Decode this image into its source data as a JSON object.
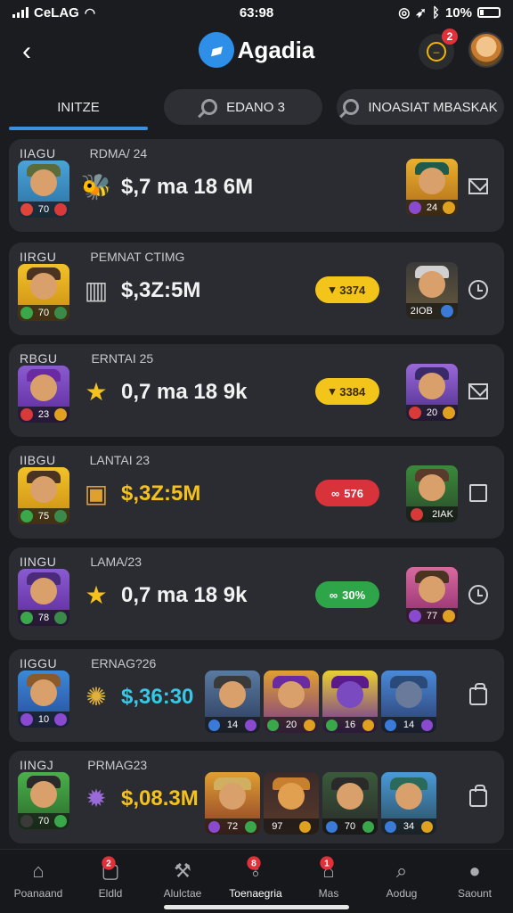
{
  "status": {
    "carrier": "CeLAG",
    "time": "63:98",
    "battery": "10%"
  },
  "header": {
    "title": "Agadia",
    "notif_count": "2"
  },
  "tabs": [
    {
      "label": "INITZE"
    },
    {
      "label": "EDANO 3"
    },
    {
      "label": "INOASIAT MBASKAK"
    }
  ],
  "rows": [
    {
      "tag": "IIAGU",
      "date": "RDMA/ 24",
      "amount": "$,7 ma 18 6M",
      "gem_icon": "bee-icon",
      "hero_level": "70",
      "right_level": "24",
      "action_icon": "mail-icon"
    },
    {
      "tag": "IIRGU",
      "date": "PEMNAT CTIMG",
      "amount": "$,3Z:5M",
      "gem_icon": "tower-icon",
      "hero_level": "70",
      "pill": "3374",
      "pill_style": "yellow",
      "right_level": "2IOB",
      "action_icon": "clock-icon"
    },
    {
      "tag": "RBGU",
      "date": "ERNTAI 25",
      "amount": "0,7 ma 18 9k",
      "gem_icon": "star-icon",
      "hero_level": "23",
      "pill": "3384",
      "pill_style": "yellow",
      "right_level": "20",
      "action_icon": "mail-icon"
    },
    {
      "tag": "IIBGU",
      "date": "LANTAI 23",
      "amount": "$,3Z:5M",
      "gem_icon": "chest-icon",
      "hero_level": "75",
      "pill": "576",
      "pill_style": "red",
      "right_level": "2IAK",
      "action_icon": "square-icon"
    },
    {
      "tag": "IINGU",
      "date": "LAMA/23",
      "amount": "0,7 ma 18 9k",
      "gem_icon": "star-icon",
      "hero_level": "78",
      "pill": "30%",
      "pill_style": "green",
      "right_level": "77",
      "action_icon": "clock-icon"
    },
    {
      "tag": "IIGGU",
      "date": "ERNAG?26",
      "amount": "$,36:30",
      "gem_icon": "coin-icon",
      "hero_level": "10",
      "minis": [
        "14",
        "20",
        "16",
        "14"
      ],
      "action_icon": "bag-icon"
    },
    {
      "tag": "IINGJ",
      "date": "PRMAG23",
      "amount": "$,08.3M",
      "gem_icon": "spike-icon",
      "hero_level": "70",
      "minis": [
        "72",
        "97",
        "70",
        "34"
      ],
      "action_icon": "bag-icon"
    }
  ],
  "nav": [
    {
      "label": "Poanaand",
      "icon": "home-icon"
    },
    {
      "label": "Eldld",
      "icon": "frame-icon",
      "badge": "2"
    },
    {
      "label": "Alulctae",
      "icon": "tools-icon"
    },
    {
      "label": "Toenaegria",
      "icon": "trophy-icon",
      "badge": "8"
    },
    {
      "label": "Mas",
      "icon": "house-icon",
      "badge": "1"
    },
    {
      "label": "Aodug",
      "icon": "search-icon"
    },
    {
      "label": "Saount",
      "icon": "user-icon"
    }
  ]
}
